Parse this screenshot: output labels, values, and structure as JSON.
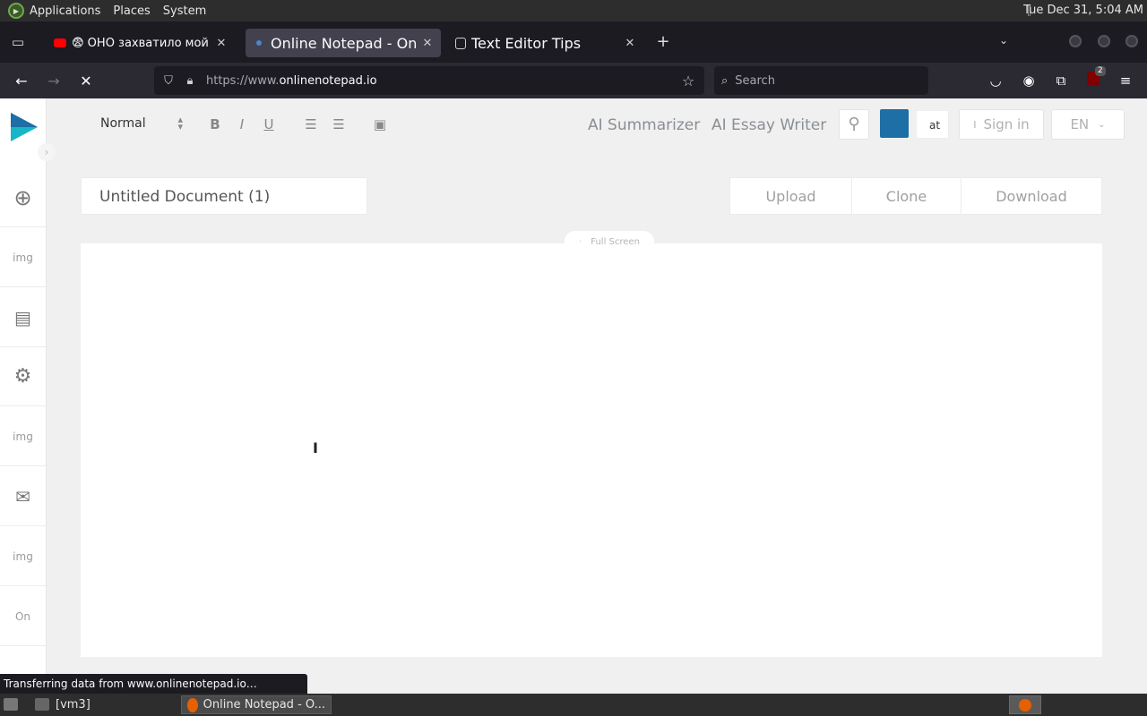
{
  "system_panel": {
    "menus": [
      "Applications",
      "Places",
      "System"
    ],
    "clock": "Tue Dec 31,  5:04 AM"
  },
  "browser": {
    "tabs": [
      {
        "title": "😨 ОНО захватило мой мир",
        "favicon": "youtube-icon",
        "active": false
      },
      {
        "title": "Online Notepad - Online Te",
        "favicon": "loading-icon",
        "active": true
      },
      {
        "title": "Text Editor Tips",
        "favicon": "page-icon",
        "active": false
      }
    ],
    "url_prefix": "https://www.",
    "url_domain": "onlinenotepad.io",
    "search_placeholder": "Search",
    "extension_badge": "2",
    "accent_color": "#1c1b22"
  },
  "page": {
    "format_select": "Normal",
    "top_links": [
      "AI Summarizer",
      "AI Essay Writer"
    ],
    "tiny_box_text": "at",
    "color_swatch": "#1d6fa5",
    "sign_in": "Sign in",
    "sign_in_icon_text": "I",
    "language": "EN",
    "document_title": "Untitled Document (1)",
    "actions": [
      "Upload",
      "Clone",
      "Download"
    ],
    "full_screen": "Full Screen",
    "sidebar_labels": [
      "img",
      "img",
      "img",
      "On"
    ]
  },
  "status_bar": "Transferring data from www.onlinenotepad.io…",
  "taskbar": {
    "items": [
      "[vm3]",
      "Online Notepad - O..."
    ]
  }
}
